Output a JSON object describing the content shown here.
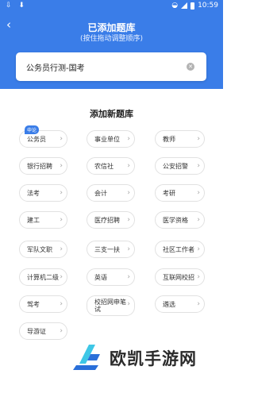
{
  "status_bar": {
    "left_icons": "⇩ ⬇",
    "time": "10:59"
  },
  "header": {
    "back_icon": "chevron-left-icon",
    "title": "已添加题库",
    "subtitle": "(按住拖动调整顺序)",
    "background_color": "#3a7de8"
  },
  "selected": {
    "text": "公务员行测-国考"
  },
  "section": {
    "title": "添加新题库"
  },
  "chips": [
    {
      "label": "公务员",
      "badge": "申论"
    },
    {
      "label": "事业单位"
    },
    {
      "label": "教师"
    },
    {
      "label": "银行招聘"
    },
    {
      "label": "农信社"
    },
    {
      "label": "公安招警"
    },
    {
      "label": "法考"
    },
    {
      "label": "会计"
    },
    {
      "label": "考研"
    },
    {
      "label": "建工"
    },
    {
      "label": "医疗招聘"
    },
    {
      "label": "医学资格"
    },
    {
      "label": "军队文职"
    },
    {
      "label": "三支一扶"
    },
    {
      "label": "社区工作者"
    },
    {
      "label": "计算机二级"
    },
    {
      "label": "英语"
    },
    {
      "label": "互联网校招"
    },
    {
      "label": "驾考"
    },
    {
      "label": "校招网申笔试"
    },
    {
      "label": "遴选"
    },
    {
      "label": "导游证"
    }
  ],
  "watermark": {
    "text": "欧凯手游网"
  }
}
